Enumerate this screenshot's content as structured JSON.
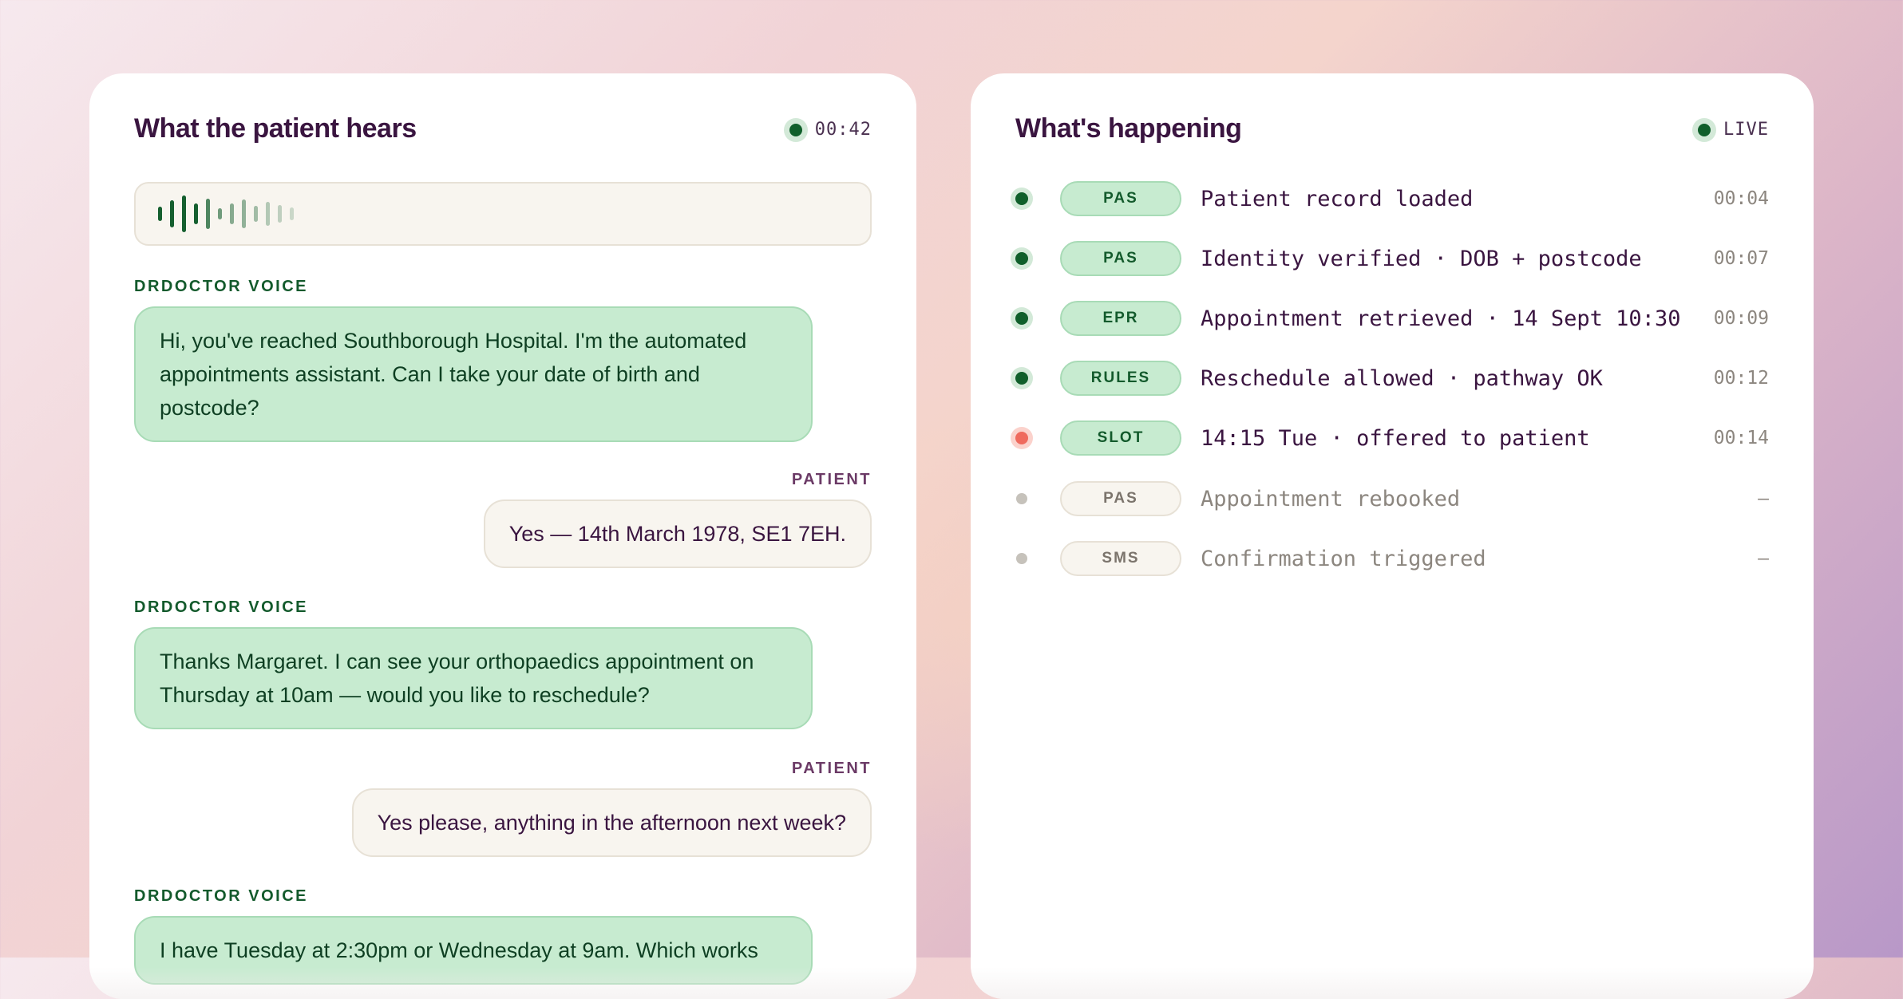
{
  "left_panel": {
    "title": "What the patient hears",
    "timer": "00:42",
    "waveform_level": 0.45,
    "messages": [
      {
        "speaker": "DRDOCTOR VOICE",
        "text": "Hi, you've reached Southborough Hospital. I'm the automated appointments assistant. Can I take your date of birth and postcode?"
      },
      {
        "speaker": "PATIENT",
        "text": "Yes — 14th March 1978, SE1 7EH."
      },
      {
        "speaker": "DRDOCTOR VOICE",
        "text": "Thanks Margaret. I can see your orthopaedics appointment on Thursday at 10am — would you like to reschedule?"
      },
      {
        "speaker": "PATIENT",
        "text": "Yes please, anything in the afternoon next week?"
      },
      {
        "speaker": "DRDOCTOR VOICE",
        "text": "I have Tuesday at 2:30pm or Wednesday at 9am. Which works"
      }
    ]
  },
  "right_panel": {
    "title": "What's happening",
    "status": "LIVE",
    "events": [
      {
        "tag": "PAS",
        "text": "Patient record loaded",
        "time": "00:04",
        "state": "done"
      },
      {
        "tag": "PAS",
        "text": "Identity verified · DOB + postcode",
        "time": "00:07",
        "state": "done"
      },
      {
        "tag": "EPR",
        "text": "Appointment retrieved · 14 Sept 10:30",
        "time": "00:09",
        "state": "done"
      },
      {
        "tag": "RULES",
        "text": "Reschedule allowed · pathway OK",
        "time": "00:12",
        "state": "done"
      },
      {
        "tag": "SLOT",
        "text": "14:15 Tue · offered to patient",
        "time": "00:14",
        "state": "active"
      },
      {
        "tag": "PAS",
        "text": "Appointment rebooked",
        "time": "—",
        "state": "pending"
      },
      {
        "tag": "SMS",
        "text": "Confirmation triggered",
        "time": "—",
        "state": "pending"
      }
    ]
  },
  "colors": {
    "brand_dark": "#3a1540",
    "agent_green": "#135a2c",
    "agent_bubble": "#c7ebd0",
    "active_red": "#ef6a5e"
  }
}
